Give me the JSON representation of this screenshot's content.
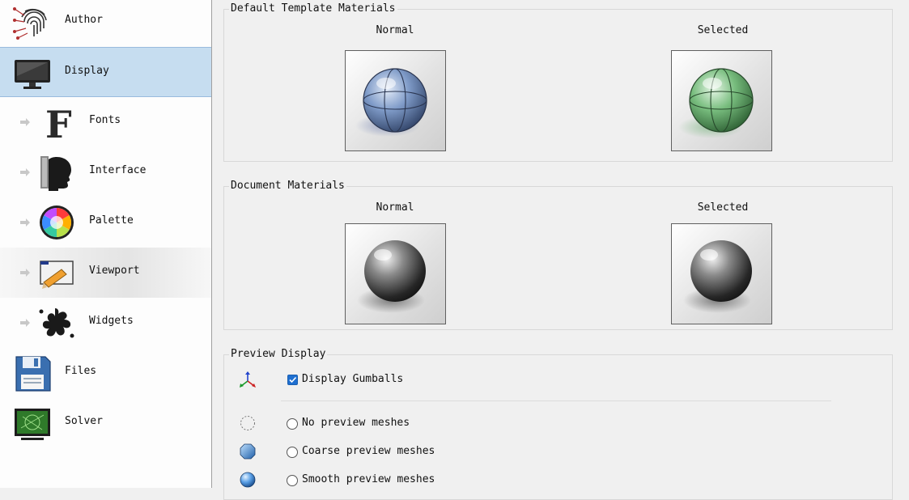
{
  "sidebar": {
    "items": [
      {
        "label": "Author",
        "icon": "fingerprint-icon"
      },
      {
        "label": "Display",
        "icon": "monitor-icon"
      },
      {
        "label": "Fonts",
        "icon": "font-f-icon"
      },
      {
        "label": "Interface",
        "icon": "head-silhouette-icon"
      },
      {
        "label": "Palette",
        "icon": "color-wheel-icon"
      },
      {
        "label": "Viewport",
        "icon": "viewport-pencil-icon"
      },
      {
        "label": "Widgets",
        "icon": "splat-icon"
      },
      {
        "label": "Files",
        "icon": "floppy-disk-icon"
      },
      {
        "label": "Solver",
        "icon": "solver-screen-icon"
      }
    ],
    "selected": "Display"
  },
  "default_template": {
    "title": "Default Template Materials",
    "normal_label": "Normal",
    "selected_label": "Selected",
    "normal_color": "#6d89b8",
    "selected_color": "#6fb57a"
  },
  "document_materials": {
    "title": "Document Materials",
    "normal_label": "Normal",
    "selected_label": "Selected",
    "normal_color": "#4a4a4a",
    "selected_color": "#4a4a4a"
  },
  "preview_display": {
    "title": "Preview Display",
    "display_gumballs": {
      "label": "Display Gumballs",
      "checked": true,
      "icon": "gumball-axes-icon"
    },
    "options": [
      {
        "label": "No preview meshes",
        "icon": "dotted-circle-icon",
        "selected": false
      },
      {
        "label": "Coarse preview meshes",
        "icon": "coarse-sphere-icon",
        "selected": false
      },
      {
        "label": "Smooth preview meshes",
        "icon": "smooth-sphere-icon",
        "selected": false
      }
    ]
  },
  "colors": {
    "accent": "#1f6fd0",
    "selection": "#c6ddf0"
  }
}
